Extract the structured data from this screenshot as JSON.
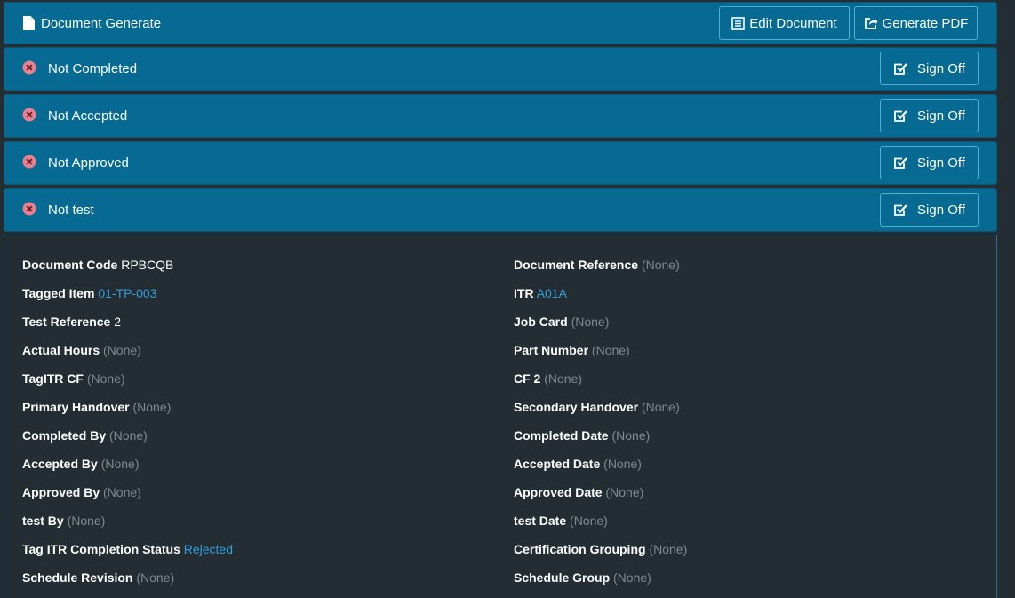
{
  "header": {
    "title": "Document Generate",
    "edit_label": "Edit Document",
    "pdf_label": "Generate PDF"
  },
  "statuses": [
    {
      "label": "Not Completed",
      "button": "Sign Off"
    },
    {
      "label": "Not Accepted",
      "button": "Sign Off"
    },
    {
      "label": "Not Approved",
      "button": "Sign Off"
    },
    {
      "label": "Not test",
      "button": "Sign Off"
    }
  ],
  "details": {
    "left": [
      {
        "label": "Document Code",
        "value": "RPBCQB",
        "kind": "text"
      },
      {
        "label": "Tagged Item",
        "value": "01-TP-003",
        "kind": "link"
      },
      {
        "label": "Test Reference",
        "value": "2",
        "kind": "text"
      },
      {
        "label": "Actual Hours",
        "value": "(None)",
        "kind": "none"
      },
      {
        "label": "TagITR CF",
        "value": "(None)",
        "kind": "none"
      },
      {
        "label": "Primary Handover",
        "value": "(None)",
        "kind": "none"
      },
      {
        "label": "Completed By",
        "value": "(None)",
        "kind": "none"
      },
      {
        "label": "Accepted By",
        "value": "(None)",
        "kind": "none"
      },
      {
        "label": "Approved By",
        "value": "(None)",
        "kind": "none"
      },
      {
        "label": "test By",
        "value": "(None)",
        "kind": "none"
      },
      {
        "label": "Tag ITR Completion Status",
        "value": "Rejected",
        "kind": "link"
      },
      {
        "label": "Schedule Revision",
        "value": "(None)",
        "kind": "none"
      }
    ],
    "right": [
      {
        "label": "Document Reference",
        "value": "(None)",
        "kind": "none"
      },
      {
        "label": "ITR",
        "value": "A01A",
        "kind": "link"
      },
      {
        "label": "Job Card",
        "value": "(None)",
        "kind": "none"
      },
      {
        "label": "Part Number",
        "value": "(None)",
        "kind": "none"
      },
      {
        "label": "CF 2",
        "value": "(None)",
        "kind": "none"
      },
      {
        "label": "Secondary Handover",
        "value": "(None)",
        "kind": "none"
      },
      {
        "label": "Completed Date",
        "value": "(None)",
        "kind": "none"
      },
      {
        "label": "Accepted Date",
        "value": "(None)",
        "kind": "none"
      },
      {
        "label": "Approved Date",
        "value": "(None)",
        "kind": "none"
      },
      {
        "label": "test Date",
        "value": "(None)",
        "kind": "none"
      },
      {
        "label": "Certification Grouping",
        "value": "(None)",
        "kind": "none"
      },
      {
        "label": "Schedule Group",
        "value": "(None)",
        "kind": "none"
      }
    ]
  },
  "colors": {
    "bar_bg": "#066a92",
    "page_bg": "#232d33",
    "link": "#2f9fdc",
    "muted": "#7d8a91",
    "status_icon": "#e8808f"
  },
  "icons": {
    "header": "document-icon",
    "edit": "list-document-icon",
    "pdf": "export-icon",
    "status": "x-circle-icon",
    "sign": "checkbox-icon"
  }
}
